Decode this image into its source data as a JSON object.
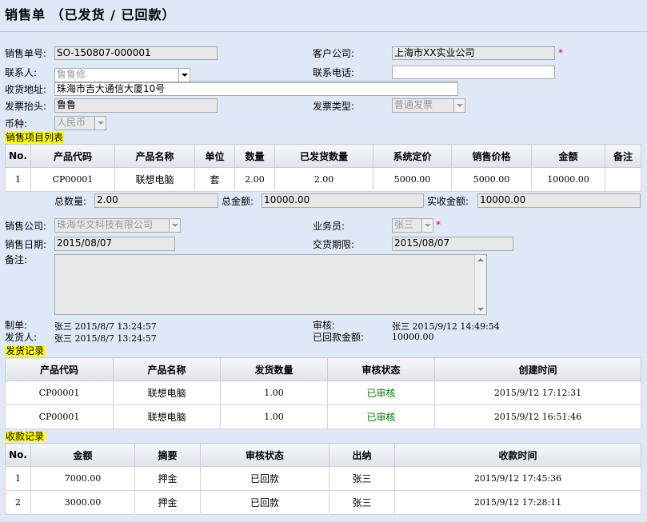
{
  "page": {
    "title": "销售单 （已发货 / 已回款）"
  },
  "header": {
    "order_no_label": "销售单号:",
    "order_no": "SO-150807-000001",
    "customer_label": "客户公司:",
    "customer": "上海市XX实业公司",
    "required_mark": "*",
    "contact_label": "联系人:",
    "contact": "鲁鲁修",
    "phone_label": "联系电话:",
    "phone": "",
    "address_label": "收货地址:",
    "address": "珠海市吉大通信大厦10号",
    "invoice_title_label": "发票抬头:",
    "invoice_title": "鲁鲁",
    "invoice_type_label": "发票类型:",
    "invoice_type": "普通发票",
    "currency_label": "币种:",
    "currency": "人民币"
  },
  "items_section": {
    "title": "销售项目列表",
    "columns": [
      "No.",
      "产品代码",
      "产品名称",
      "单位",
      "数量",
      "已发货数量",
      "系统定价",
      "销售价格",
      "金额",
      "备注"
    ],
    "rows": [
      {
        "no": "1",
        "code": "CP00001",
        "name": "联想电脑",
        "unit": "套",
        "qty": "2.00",
        "shipped": "2.00",
        "list_price": "5000.00",
        "sale_price": "5000.00",
        "amount": "10000.00",
        "note": ""
      }
    ],
    "total_qty_label": "总数量:",
    "total_qty": "2.00",
    "total_amount_label": "总金额:",
    "total_amount": "10000.00",
    "received_label": "实收金额:",
    "received": "10000.00"
  },
  "sales": {
    "company_label": "销售公司:",
    "company": "珠海华文科技有限公司",
    "salesman_label": "业务员:",
    "salesman": "张三",
    "required_mark": "*",
    "date_label": "销售日期:",
    "date": "2015/08/07",
    "delivery_label": "交货期限:",
    "delivery": "2015/08/07",
    "remark_label": "备注:"
  },
  "meta": {
    "creator_label": "制单:",
    "creator": "张三 2015/8/7 13:24:57",
    "shipper_label": "发货人:",
    "shipper": "张三 2015/8/7 13:24:57",
    "auditor_label": "审核:",
    "auditor": "张三 2015/9/12 14:49:54",
    "paid_label": "已回款金额:",
    "paid": "10000.00"
  },
  "shipping": {
    "title": "发货记录",
    "columns": [
      "产品代码",
      "产品名称",
      "发货数量",
      "审核状态",
      "创建时间"
    ],
    "rows": [
      {
        "code": "CP00001",
        "name": "联想电脑",
        "qty": "1.00",
        "status": "已审核",
        "time": "2015/9/12 17:12:31"
      },
      {
        "code": "CP00001",
        "name": "联想电脑",
        "qty": "1.00",
        "status": "已审核",
        "time": "2015/9/12 16:51:46"
      }
    ]
  },
  "payments": {
    "title": "收款记录",
    "columns": [
      "No.",
      "金额",
      "摘要",
      "审核状态",
      "出纳",
      "收款时间"
    ],
    "rows": [
      {
        "no": "1",
        "amount": "7000.00",
        "summary": "押金",
        "status": "已回款",
        "cashier": "张三",
        "time": "2015/9/12 17:45:36"
      },
      {
        "no": "2",
        "amount": "3000.00",
        "summary": "押金",
        "status": "已回款",
        "cashier": "张三",
        "time": "2015/9/12 17:28:11"
      }
    ]
  }
}
